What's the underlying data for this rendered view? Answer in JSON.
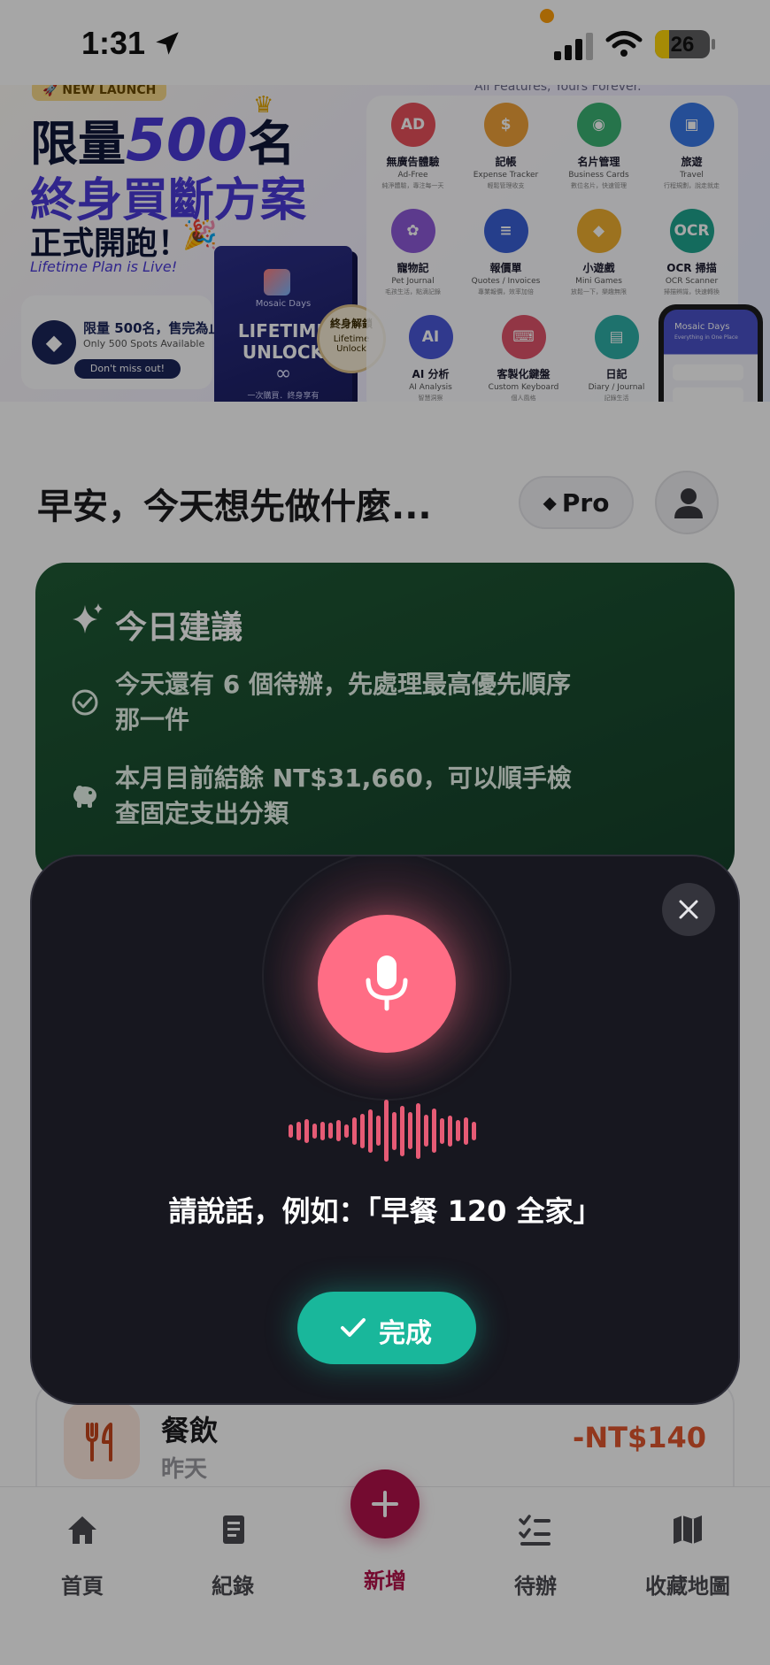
{
  "status_bar": {
    "time": "1:31",
    "battery": "26"
  },
  "banner": {
    "launch_tag": "🚀 NEW LAUNCH",
    "features_caption": "All Features, Yours Forever.",
    "headline_a": "限量",
    "headline_num": "500",
    "headline_b": "名",
    "headline_2": "終身買斷方案",
    "headline_3": "正式開跑！",
    "headline_en": "Lifetime Plan is Live!",
    "spots_zh": "限量 500名，售完為止",
    "spots_en": "Only 500 Spots Available",
    "spots_cta": "Don't miss out!",
    "product_brand": "Mosaic Days",
    "product_l1": "LIFETIME",
    "product_l2": "UNLOCK",
    "product_inf": "∞",
    "product_foot": "一次購買．終身享有",
    "unlock_zh": "終身解鎖",
    "unlock_en1": "Lifetime",
    "unlock_en2": "Unlock",
    "features": [
      {
        "zh": "無廣告體驗",
        "en": "Ad-Free",
        "desc": "純淨體驗，專注每一天",
        "glyph": "AD",
        "color": "#e8505b"
      },
      {
        "zh": "記帳",
        "en": "Expense Tracker",
        "desc": "輕鬆管理收支",
        "glyph": "$",
        "color": "#f0a23a"
      },
      {
        "zh": "名片管理",
        "en": "Business Cards",
        "desc": "數位名片，快速管理",
        "glyph": "◉",
        "color": "#3bb273"
      },
      {
        "zh": "旅遊",
        "en": "Travel",
        "desc": "行程規劃，說走就走",
        "glyph": "▣",
        "color": "#3a79e6"
      },
      {
        "zh": "寵物記",
        "en": "Pet Journal",
        "desc": "毛孩生活，點滴記錄",
        "glyph": "✿",
        "color": "#8e5ad9"
      },
      {
        "zh": "報價單",
        "en": "Quotes / Invoices",
        "desc": "專業報價，效率加倍",
        "glyph": "≡",
        "color": "#3a60d6"
      },
      {
        "zh": "小遊戲",
        "en": "Mini Games",
        "desc": "放鬆一下，樂趣無限",
        "glyph": "◆",
        "color": "#f0b030"
      },
      {
        "zh": "OCR 掃描",
        "en": "OCR Scanner",
        "desc": "掃描辨識，快速轉換",
        "glyph": "OCR",
        "color": "#1fa58f"
      },
      {
        "zh": "AI 分析",
        "en": "AI Analysis",
        "desc": "智慧洞察",
        "glyph": "AI",
        "color": "#4a58d9"
      },
      {
        "zh": "客製化鍵盤",
        "en": "Custom Keyboard",
        "desc": "個人風格",
        "glyph": "⌨",
        "color": "#e0546b"
      },
      {
        "zh": "日記",
        "en": "Diary / Journal",
        "desc": "記錄生活",
        "glyph": "▤",
        "color": "#2fb0a8"
      }
    ],
    "phone_title": "Mosaic Days",
    "phone_sub": "Everything in One Place"
  },
  "home": {
    "greeting": "早安，今天想先做什麼...",
    "pro_label": "Pro"
  },
  "suggestion": {
    "title": "今日建議",
    "items": [
      {
        "icon": "check-circle-icon",
        "text": "今天還有 6 個待辦，先處理最高優先順序那一件"
      },
      {
        "icon": "piggy-bank-icon",
        "text": "本月目前結餘 NT$31,660，可以順手檢查固定支出分類"
      }
    ]
  },
  "recent": {
    "category": "餐飲",
    "date": "昨天",
    "amount": "-NT$140"
  },
  "tabs": {
    "home": "首頁",
    "records": "紀錄",
    "add": "新增",
    "todo": "待辦",
    "map": "收藏地圖"
  },
  "voice": {
    "prompt": "請說話，例如：「早餐 120 全家」",
    "done_label": "完成",
    "wave_levels": [
      0.22,
      0.3,
      0.38,
      0.24,
      0.3,
      0.26,
      0.34,
      0.22,
      0.44,
      0.56,
      0.7,
      0.48,
      1.0,
      0.62,
      0.82,
      0.6,
      0.9,
      0.52,
      0.72,
      0.42,
      0.5,
      0.34,
      0.44,
      0.3
    ]
  },
  "colors": {
    "accent": "#b3124a",
    "mic": "#ff6d85",
    "done": "#19b79b",
    "suggestion_bg": "#1f5a35",
    "expense": "#e0572e"
  }
}
